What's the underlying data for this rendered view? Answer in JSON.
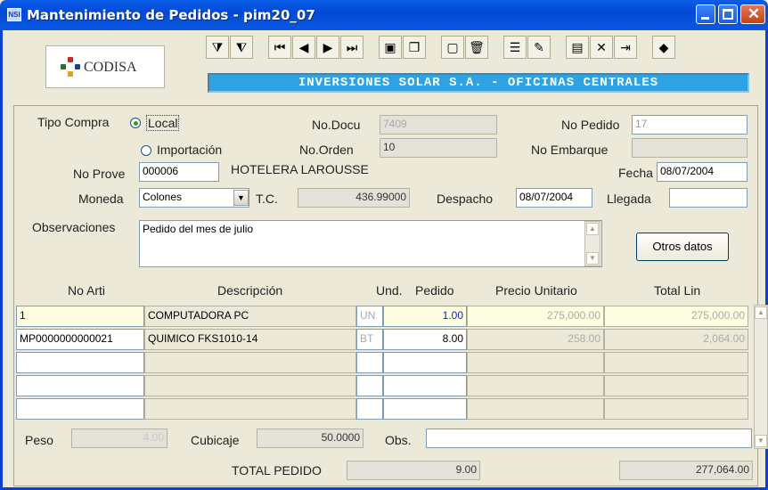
{
  "window": {
    "title": "Mantenimiento de Pedidos  -  pim20_07",
    "icon_text": "NSI"
  },
  "logo": {
    "text": "CODISA",
    "trademark": "*"
  },
  "company_banner": "INVERSIONES SOLAR S.A. - OFICINAS CENTRALES",
  "toolbar_icons": [
    "filter-query-icon",
    "filter-clear-icon",
    "first-record-icon",
    "prev-record-icon",
    "next-record-icon",
    "last-record-icon",
    "save-icon",
    "copy-icon",
    "new-document-icon",
    "delete-icon",
    "insert-line-icon",
    "edit-icon",
    "report-icon",
    "tools-icon",
    "exit-icon",
    "help-book-icon"
  ],
  "form": {
    "tipo_compra_label": "Tipo Compra",
    "local_label": "Local",
    "importacion_label": "Importación",
    "no_docu_label": "No.Docu",
    "no_docu_value": "7409",
    "no_pedido_label": "No Pedido",
    "no_pedido_value": "17",
    "no_orden_label": "No.Orden",
    "no_orden_value": "10",
    "no_embarque_label": "No Embarque",
    "no_embarque_value": "",
    "no_prove_label": "No Prove",
    "no_prove_value": "000006",
    "proveedor_nombre": "HOTELERA LAROUSSE",
    "fecha_label": "Fecha",
    "fecha_value": "08/07/2004",
    "moneda_label": "Moneda",
    "moneda_value": "Colones",
    "tc_label": "T.C.",
    "tc_value": "436.99000",
    "despacho_label": "Despacho",
    "despacho_value": "08/07/2004",
    "llegada_label": "Llegada",
    "llegada_value": "",
    "observaciones_label": "Observaciones",
    "observaciones_value": "Pedido del mes de julio",
    "otros_datos_button": "Otros datos"
  },
  "grid": {
    "headers": [
      "No Arti",
      "Descripción",
      "Und.",
      "Pedido",
      "Precio Unitario",
      "Total Lin"
    ],
    "rows": [
      {
        "articulo": "1",
        "descripcion": "COMPUTADORA PC",
        "und": "UN",
        "pedido": "1.00",
        "precio": "275,000.00",
        "total": "275,000.00"
      },
      {
        "articulo": "MP0000000000021",
        "descripcion": "QUIMICO  FKS1010-14",
        "und": "BT",
        "pedido": "8.00",
        "precio": "258.00",
        "total": "2,064.00"
      },
      {
        "articulo": "",
        "descripcion": "",
        "und": "",
        "pedido": "",
        "precio": "",
        "total": ""
      },
      {
        "articulo": "",
        "descripcion": "",
        "und": "",
        "pedido": "",
        "precio": "",
        "total": ""
      },
      {
        "articulo": "",
        "descripcion": "",
        "und": "",
        "pedido": "",
        "precio": "",
        "total": ""
      }
    ]
  },
  "footer": {
    "peso_label": "Peso",
    "peso_value": "4.00",
    "cubicaje_label": "Cubicaje",
    "cubicaje_value": "50.0000",
    "obs_label": "Obs.",
    "obs_value": "",
    "total_pedido_label": "TOTAL PEDIDO",
    "total_pedido_qty": "9.00",
    "total_pedido_amount": "277,064.00"
  },
  "colors": {
    "titlebar": "#0a5ee8",
    "banner": "#2ea3e4",
    "window_bg": "#ece9d8"
  }
}
